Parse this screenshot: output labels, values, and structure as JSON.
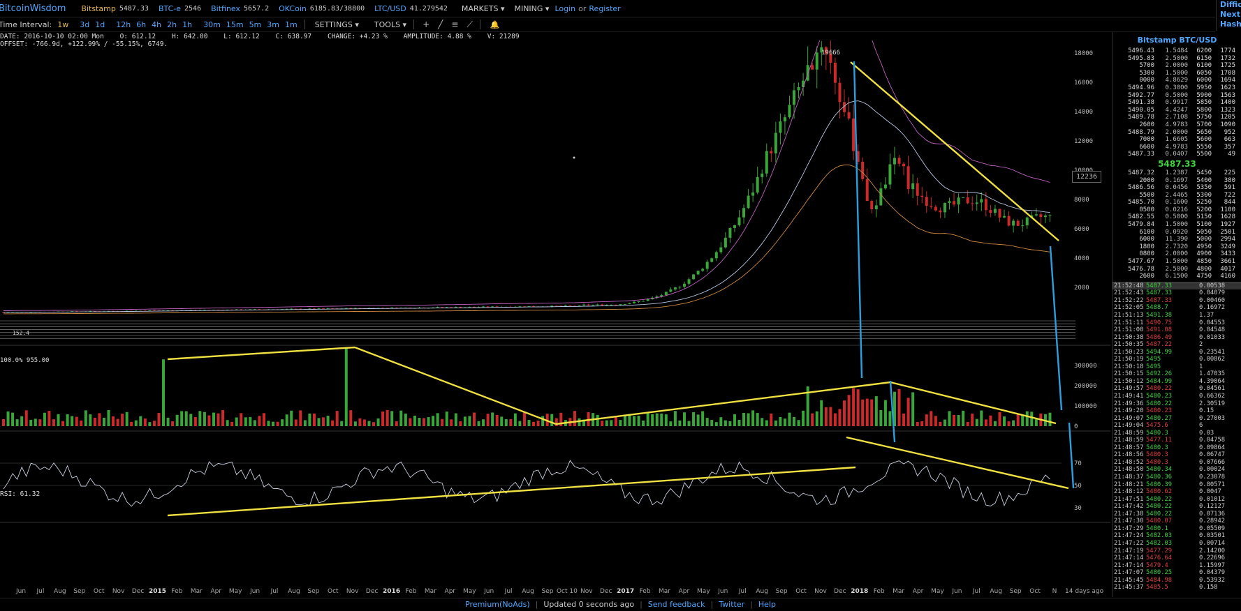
{
  "topbar": {
    "brand": "BitcoinWisdom",
    "exchanges": [
      {
        "name": "Bitstamp",
        "value": "5487.33",
        "color": "orange"
      },
      {
        "name": "BTC-e",
        "value": "2546",
        "color": "blue"
      },
      {
        "name": "Bitfinex",
        "value": "5657.2",
        "color": "blue"
      },
      {
        "name": "OKCoin",
        "value": "6185.83/38800",
        "color": "blue"
      },
      {
        "name": "LTC/USD",
        "value": "41.279542",
        "color": "blue"
      }
    ],
    "markets_label": "MARKETS ▾",
    "mining_label": "MINING ▾",
    "login_label": "Login",
    "or_label": "or",
    "register_label": "Register"
  },
  "diff_box": {
    "line1": "Difficu",
    "line2": "Next",
    "line3": "Hash R"
  },
  "toolbar": {
    "interval_label": "Time Interval:",
    "intervals": [
      "1w",
      "3d",
      "1d",
      "12h",
      "6h",
      "4h",
      "2h",
      "1h",
      "30m",
      "15m",
      "5m",
      "3m",
      "1m"
    ],
    "active_interval": "1w",
    "settings_label": "SETTINGS ▾",
    "tools_label": "TOOLS ▾",
    "tool_icons": [
      "+",
      "╱",
      "≡",
      "⟋"
    ],
    "bell_icon": "🔔"
  },
  "info": {
    "line1": "DATE: 2016-10-10 02:00 Mon    O: 612.12    H: 642.00    L: 612.12    C: 638.97    CHANGE: +4.23 %    AMPLITUDE: 4.88 %    V: 21289",
    "line2": "OFFSET: -766.9d, +122.99% / -55.15%, 6749."
  },
  "chart_labels": {
    "peak": "19666",
    "current_box": "12236",
    "rsi": "RSI: 61.32",
    "fib": "100.0% 955.00",
    "days_left": "14 days ago",
    "fib_low": "152.4"
  },
  "chart_data": {
    "type": "candlestick",
    "price_axis": [
      2000,
      4000,
      6000,
      8000,
      10000,
      12000,
      14000,
      16000,
      18000
    ],
    "volume_axis": [
      0,
      100000,
      200000,
      300000
    ],
    "rsi_axis": [
      30,
      50,
      70
    ],
    "x_ticks": [
      "Jun",
      "Jul",
      "Aug",
      "Sep",
      "Oct",
      "Nov",
      "Dec",
      "2015",
      "Feb",
      "Mar",
      "Apr",
      "May",
      "Jun",
      "Jul",
      "Aug",
      "Sep",
      "Oct",
      "Nov",
      "Dec",
      "2016",
      "Feb",
      "Mar",
      "Apr",
      "May",
      "Jun",
      "Jul",
      "Aug",
      "Sep",
      "Oct 10",
      "Nov",
      "Dec",
      "2017",
      "Feb",
      "Mar",
      "Apr",
      "May",
      "Jun",
      "Jul",
      "Aug",
      "Sep",
      "Oct",
      "Nov",
      "Dec",
      "2018",
      "Feb",
      "Mar",
      "Apr",
      "May",
      "Jun",
      "Jul",
      "Aug",
      "Sep",
      "Oct",
      "N"
    ],
    "price_peak": 19666,
    "last_price": 5487.33
  },
  "right_panel": {
    "title": "Bitstamp BTC/USD",
    "asks": [
      [
        "5496.43",
        "1.5484",
        "6200",
        "1774"
      ],
      [
        "5495.83",
        "2.5000",
        "6150",
        "1732"
      ],
      [
        "5700",
        "2.0000",
        "6100",
        "1725"
      ],
      [
        "5300",
        "1.5000",
        "6050",
        "1708"
      ],
      [
        "0000",
        "4.8629",
        "6000",
        "1694"
      ],
      [
        "5494.96",
        "0.3000",
        "5950",
        "1623"
      ],
      [
        "5492.77",
        "0.5000",
        "5900",
        "1563"
      ],
      [
        "5491.38",
        "0.9917",
        "5850",
        "1400"
      ],
      [
        "5490.05",
        "4.4247",
        "5800",
        "1323"
      ],
      [
        "5489.78",
        "2.7108",
        "5750",
        "1205"
      ],
      [
        "2600",
        "4.9783",
        "5700",
        "1090"
      ],
      [
        "5488.79",
        "2.0000",
        "5650",
        "952"
      ],
      [
        "7000",
        "1.6605",
        "5600",
        "663"
      ],
      [
        "6600",
        "4.9783",
        "5550",
        "357"
      ],
      [
        "5487.33",
        "0.0407",
        "5500",
        "49"
      ]
    ],
    "last_price": "5487.33",
    "bids": [
      [
        "5487.32",
        "1.2387",
        "5450",
        "225"
      ],
      [
        "2000",
        "0.1697",
        "5400",
        "380"
      ],
      [
        "5486.56",
        "0.0456",
        "5350",
        "591"
      ],
      [
        "5500",
        "2.4465",
        "5300",
        "722"
      ],
      [
        "5485.70",
        "0.1600",
        "5250",
        "844"
      ],
      [
        "0500",
        "0.0216",
        "5200",
        "1100"
      ],
      [
        "5482.55",
        "0.5000",
        "5150",
        "1628"
      ],
      [
        "5479.84",
        "1.5000",
        "5100",
        "1927"
      ],
      [
        "6100",
        "0.0920",
        "5050",
        "2501"
      ],
      [
        "6000",
        "11.390",
        "5000",
        "2994"
      ],
      [
        "1800",
        "2.7320",
        "4950",
        "3249"
      ],
      [
        "0800",
        "2.0000",
        "4900",
        "3433"
      ],
      [
        "5477.67",
        "1.5000",
        "4850",
        "3661"
      ],
      [
        "5476.78",
        "2.5000",
        "4800",
        "4017"
      ],
      [
        "2600",
        "6.1500",
        "4750",
        "4160"
      ]
    ],
    "trades": [
      [
        "21:52:48",
        "5487.33",
        "0.00538",
        "up"
      ],
      [
        "21:52:43",
        "5487.33",
        "0.04079",
        "up"
      ],
      [
        "21:52:22",
        "5487.33",
        "0.00460",
        "dn"
      ],
      [
        "21:52:05",
        "5488.7",
        "0.16972",
        "up"
      ],
      [
        "21:51:13",
        "5491.38",
        "1.37",
        "up"
      ],
      [
        "21:51:11",
        "5490.75",
        "0.04553",
        "dn"
      ],
      [
        "21:51:00",
        "5491.08",
        "0.04548",
        "dn"
      ],
      [
        "21:50:38",
        "5486.49",
        "0.01033",
        "dn"
      ],
      [
        "21:50:35",
        "5487.22",
        "2",
        "dn"
      ],
      [
        "21:50:23",
        "5494.99",
        "0.23541",
        "up"
      ],
      [
        "21:50:19",
        "5495",
        "0.00862",
        "up"
      ],
      [
        "21:50:18",
        "5495",
        "1",
        "up"
      ],
      [
        "21:50:15",
        "5492.26",
        "1.47035",
        "up"
      ],
      [
        "21:50:12",
        "5484.99",
        "4.39064",
        "up"
      ],
      [
        "21:49:57",
        "5480.22",
        "0.04561",
        "dn"
      ],
      [
        "21:49:41",
        "5480.23",
        "0.66362",
        "up"
      ],
      [
        "21:49:36",
        "5480.22",
        "2.30519",
        "up"
      ],
      [
        "21:49:20",
        "5480.23",
        "0.15",
        "dn"
      ],
      [
        "21:49:07",
        "5480.27",
        "0.27003",
        "up"
      ],
      [
        "21:49:04",
        "5475.6",
        "6",
        "dn"
      ],
      [
        "21:48:59",
        "5480.3",
        "0.03",
        "up"
      ],
      [
        "21:48:59",
        "5477.11",
        "0.04758",
        "dn"
      ],
      [
        "21:48:57",
        "5480.3",
        "0.09864",
        "up"
      ],
      [
        "21:48:56",
        "5480.3",
        "0.06747",
        "dn"
      ],
      [
        "21:48:52",
        "5480.3",
        "0.07666",
        "dn"
      ],
      [
        "21:48:50",
        "5480.34",
        "0.00024",
        "up"
      ],
      [
        "21:48:37",
        "5480.36",
        "0.23078",
        "up"
      ],
      [
        "21:48:21",
        "5480.39",
        "0.80571",
        "up"
      ],
      [
        "21:48:12",
        "5480.62",
        "0.0047",
        "dn"
      ],
      [
        "21:47:51",
        "5480.22",
        "0.01012",
        "up"
      ],
      [
        "21:47:42",
        "5480.22",
        "0.12127",
        "up"
      ],
      [
        "21:47:38",
        "5480.22",
        "0.07136",
        "up"
      ],
      [
        "21:47:30",
        "5480.07",
        "0.28942",
        "dn"
      ],
      [
        "21:47:29",
        "5480.1",
        "0.05509",
        "up"
      ],
      [
        "21:47:24",
        "5482.03",
        "0.03501",
        "up"
      ],
      [
        "21:47:22",
        "5482.03",
        "0.00714",
        "up"
      ],
      [
        "21:47:19",
        "5477.29",
        "2.14200",
        "dn"
      ],
      [
        "21:47:14",
        "5476.64",
        "0.22696",
        "dn"
      ],
      [
        "21:47:14",
        "5479.4",
        "1.15997",
        "dn"
      ],
      [
        "21:47:07",
        "5480.25",
        "0.04379",
        "up"
      ],
      [
        "21:45:45",
        "5484.98",
        "0.53932",
        "dn"
      ],
      [
        "21:45:37",
        "5485.5",
        "0.158",
        "dn"
      ]
    ]
  },
  "footer": {
    "premium": "Premium(NoAds)",
    "updated": "Updated 0 seconds ago",
    "feedback": "Send feedback",
    "twitter": "Twitter",
    "help": "Help"
  }
}
